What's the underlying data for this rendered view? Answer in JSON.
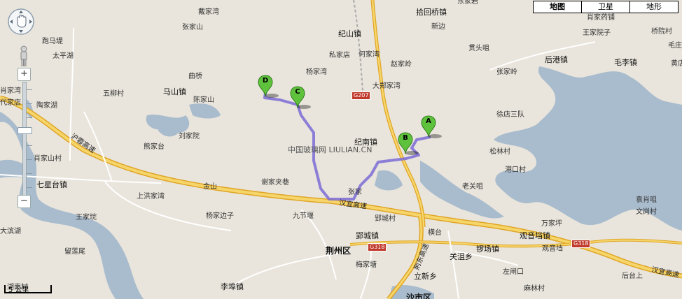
{
  "map_types": [
    "地图",
    "卫星",
    "地形"
  ],
  "active_map_type": "地图",
  "scale_label": "5 公里",
  "watermark": "中国玻璃网  LIULIAN.CN",
  "markers": [
    "A",
    "B",
    "C",
    "D"
  ],
  "highways": {
    "hu_rong": "沪蓉高速",
    "han_yi": "汉宜高速",
    "han_yi_east": "汉宜高速",
    "jing_dong": "荆东高速"
  },
  "shields": [
    "G207",
    "G318",
    "G318"
  ],
  "places": {
    "daijiawan": "戴家湾",
    "zhangjiashan": "张家山",
    "paomati": "跑马堤",
    "taipinghu": "太平湖",
    "qiaojiawan": "肖家湾",
    "wuliucun": "五柳村",
    "daijiadian": "代家店",
    "taojiahu": "陶家湖",
    "qubqiao": "曲桥",
    "mashanzhen": "马山镇",
    "chenjiashan": "陈家山",
    "liujiayuan": "刘家院",
    "xiongjiatai": "熊家台",
    "xiaojiashancun": "肖家山村",
    "qixingtaizhen": "七星台镇",
    "shanghongjiawan": "上洪家湾",
    "xiejiajiaxiang": "谢家夹巷",
    "jinshan": "金山",
    "wangjiacheng": "王家垸",
    "yangjiabianzi": "杨家边子",
    "jiujieyan": "九节堰",
    "dabinhu": "大滨湖",
    "liulianwei": "留莲尾",
    "hunancun": "湖南村",
    "lifuzhen": "李埠镇",
    "jishanzhen": "纪山镇",
    "sijiadian": "私家店",
    "hejiawan": "何家湾",
    "yangjiawan": "杨家湾",
    "zhaojialing": "赵家岭",
    "dazhengjiawan": "大郑家湾",
    "jinanzhen": "纪南镇",
    "zhangjia": "张家",
    "yingchengzhen": "郢城镇",
    "yingchengcun": "郢城村",
    "jingzhouqu": "荆州区",
    "meijiatang": "梅家塘",
    "hengtai": "横台",
    "lixinxiang": "立新乡",
    "guanjuxiang": "关沮乡",
    "shiyanggang": "沙市区",
    "shihuiqiaozhen": "拾回桥镇",
    "dongjiaian": "东家岩",
    "xinbian": "新边",
    "guantouju": "贯头咀",
    "zhangjialing": "张家岭",
    "xudiansandui": "徐店三队",
    "songlincun": "松林村",
    "gangkoucun": "港口村",
    "laoguanzui": "老关咀",
    "xiaojiayaochang": "肖家药铺",
    "wangjiayuanzi": "王家院子",
    "houganzhen": "后港镇",
    "qiaoyuancun": "桥院村",
    "maolizhen": "毛李镇",
    "maozhuang": "毛庄",
    "huangdian": "黄店",
    "yuanxiaozui": "袁肖咀",
    "wengangcun": "文岗村",
    "wanjiaping": "万家坪",
    "guanyindangzhen": "观音垱镇",
    "guanyindang": "观音垱",
    "xichangzhen": "锣场镇",
    "zuozhakou": "左闸口",
    "malincun": "麻林村",
    "houtaishang": "后台上"
  }
}
